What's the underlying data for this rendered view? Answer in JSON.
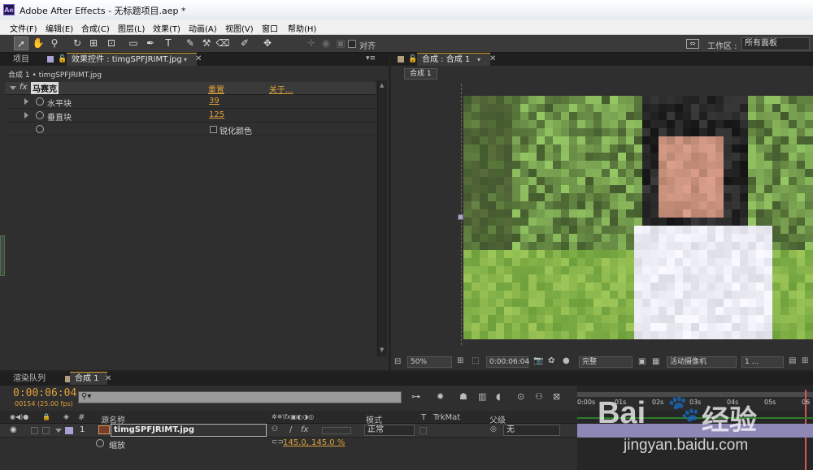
{
  "window": {
    "app_icon": "Ae",
    "title": "Adobe After Effects - 无标题项目.aep *"
  },
  "menu": [
    "文件(F)",
    "编辑(E)",
    "合成(C)",
    "图层(L)",
    "效果(T)",
    "动画(A)",
    "视图(V)",
    "窗口",
    "帮助(H)"
  ],
  "toolbar": {
    "align_label": "对齐",
    "workspace_label": "工作区 :",
    "workspace_value": "所有面板"
  },
  "left_panel": {
    "tab_project": "项目",
    "tab_effects": "效果控件 : timgSPFJRIMT.jpg",
    "breadcrumb": "合成 1 • timgSPFJRIMT.jpg",
    "effect": {
      "fx": "fx",
      "name": "马赛克",
      "reset": "重置",
      "about": "关于..."
    },
    "props": [
      {
        "label": "水平块",
        "value": "39"
      },
      {
        "label": "垂直块",
        "value": "125"
      },
      {
        "label": "锐化颜色",
        "value": ""
      }
    ]
  },
  "viewer": {
    "tab": "合成 : 合成 1",
    "subtab": "合成 1",
    "zoom": "50%",
    "timecode": "0:00:06:04",
    "quality": "完整",
    "camera": "活动摄像机",
    "views": "1 ..."
  },
  "bottom_tabs": {
    "render_queue": "渲染队列",
    "comp": "合成 1"
  },
  "timeline": {
    "timecode": "0:00:06:04",
    "frames": "00154 (25.00 fps)",
    "search_placeholder": "",
    "columns": {
      "num": "#",
      "source": "源名称",
      "mode": "模式",
      "t": "T",
      "trkmat": "TrkMat",
      "parent": "父级"
    },
    "layer": {
      "index": "1",
      "name": "timgSPFJRIMT.jpg",
      "mode": "正常",
      "parent": "无"
    },
    "sub_prop": {
      "label": "缩放",
      "value": "145.0, 145.0 %"
    },
    "ruler": [
      "0:00s",
      "01s",
      "02s",
      "03s",
      "04s",
      "05s",
      "06"
    ]
  },
  "watermark": {
    "brand": "Bai",
    "brand2": "经验",
    "url": "jingyan.baidu.com"
  },
  "colors": {
    "accent": "#e0a23a",
    "panel": "#2f2f2f",
    "label_purple": "#a9a2d6"
  }
}
